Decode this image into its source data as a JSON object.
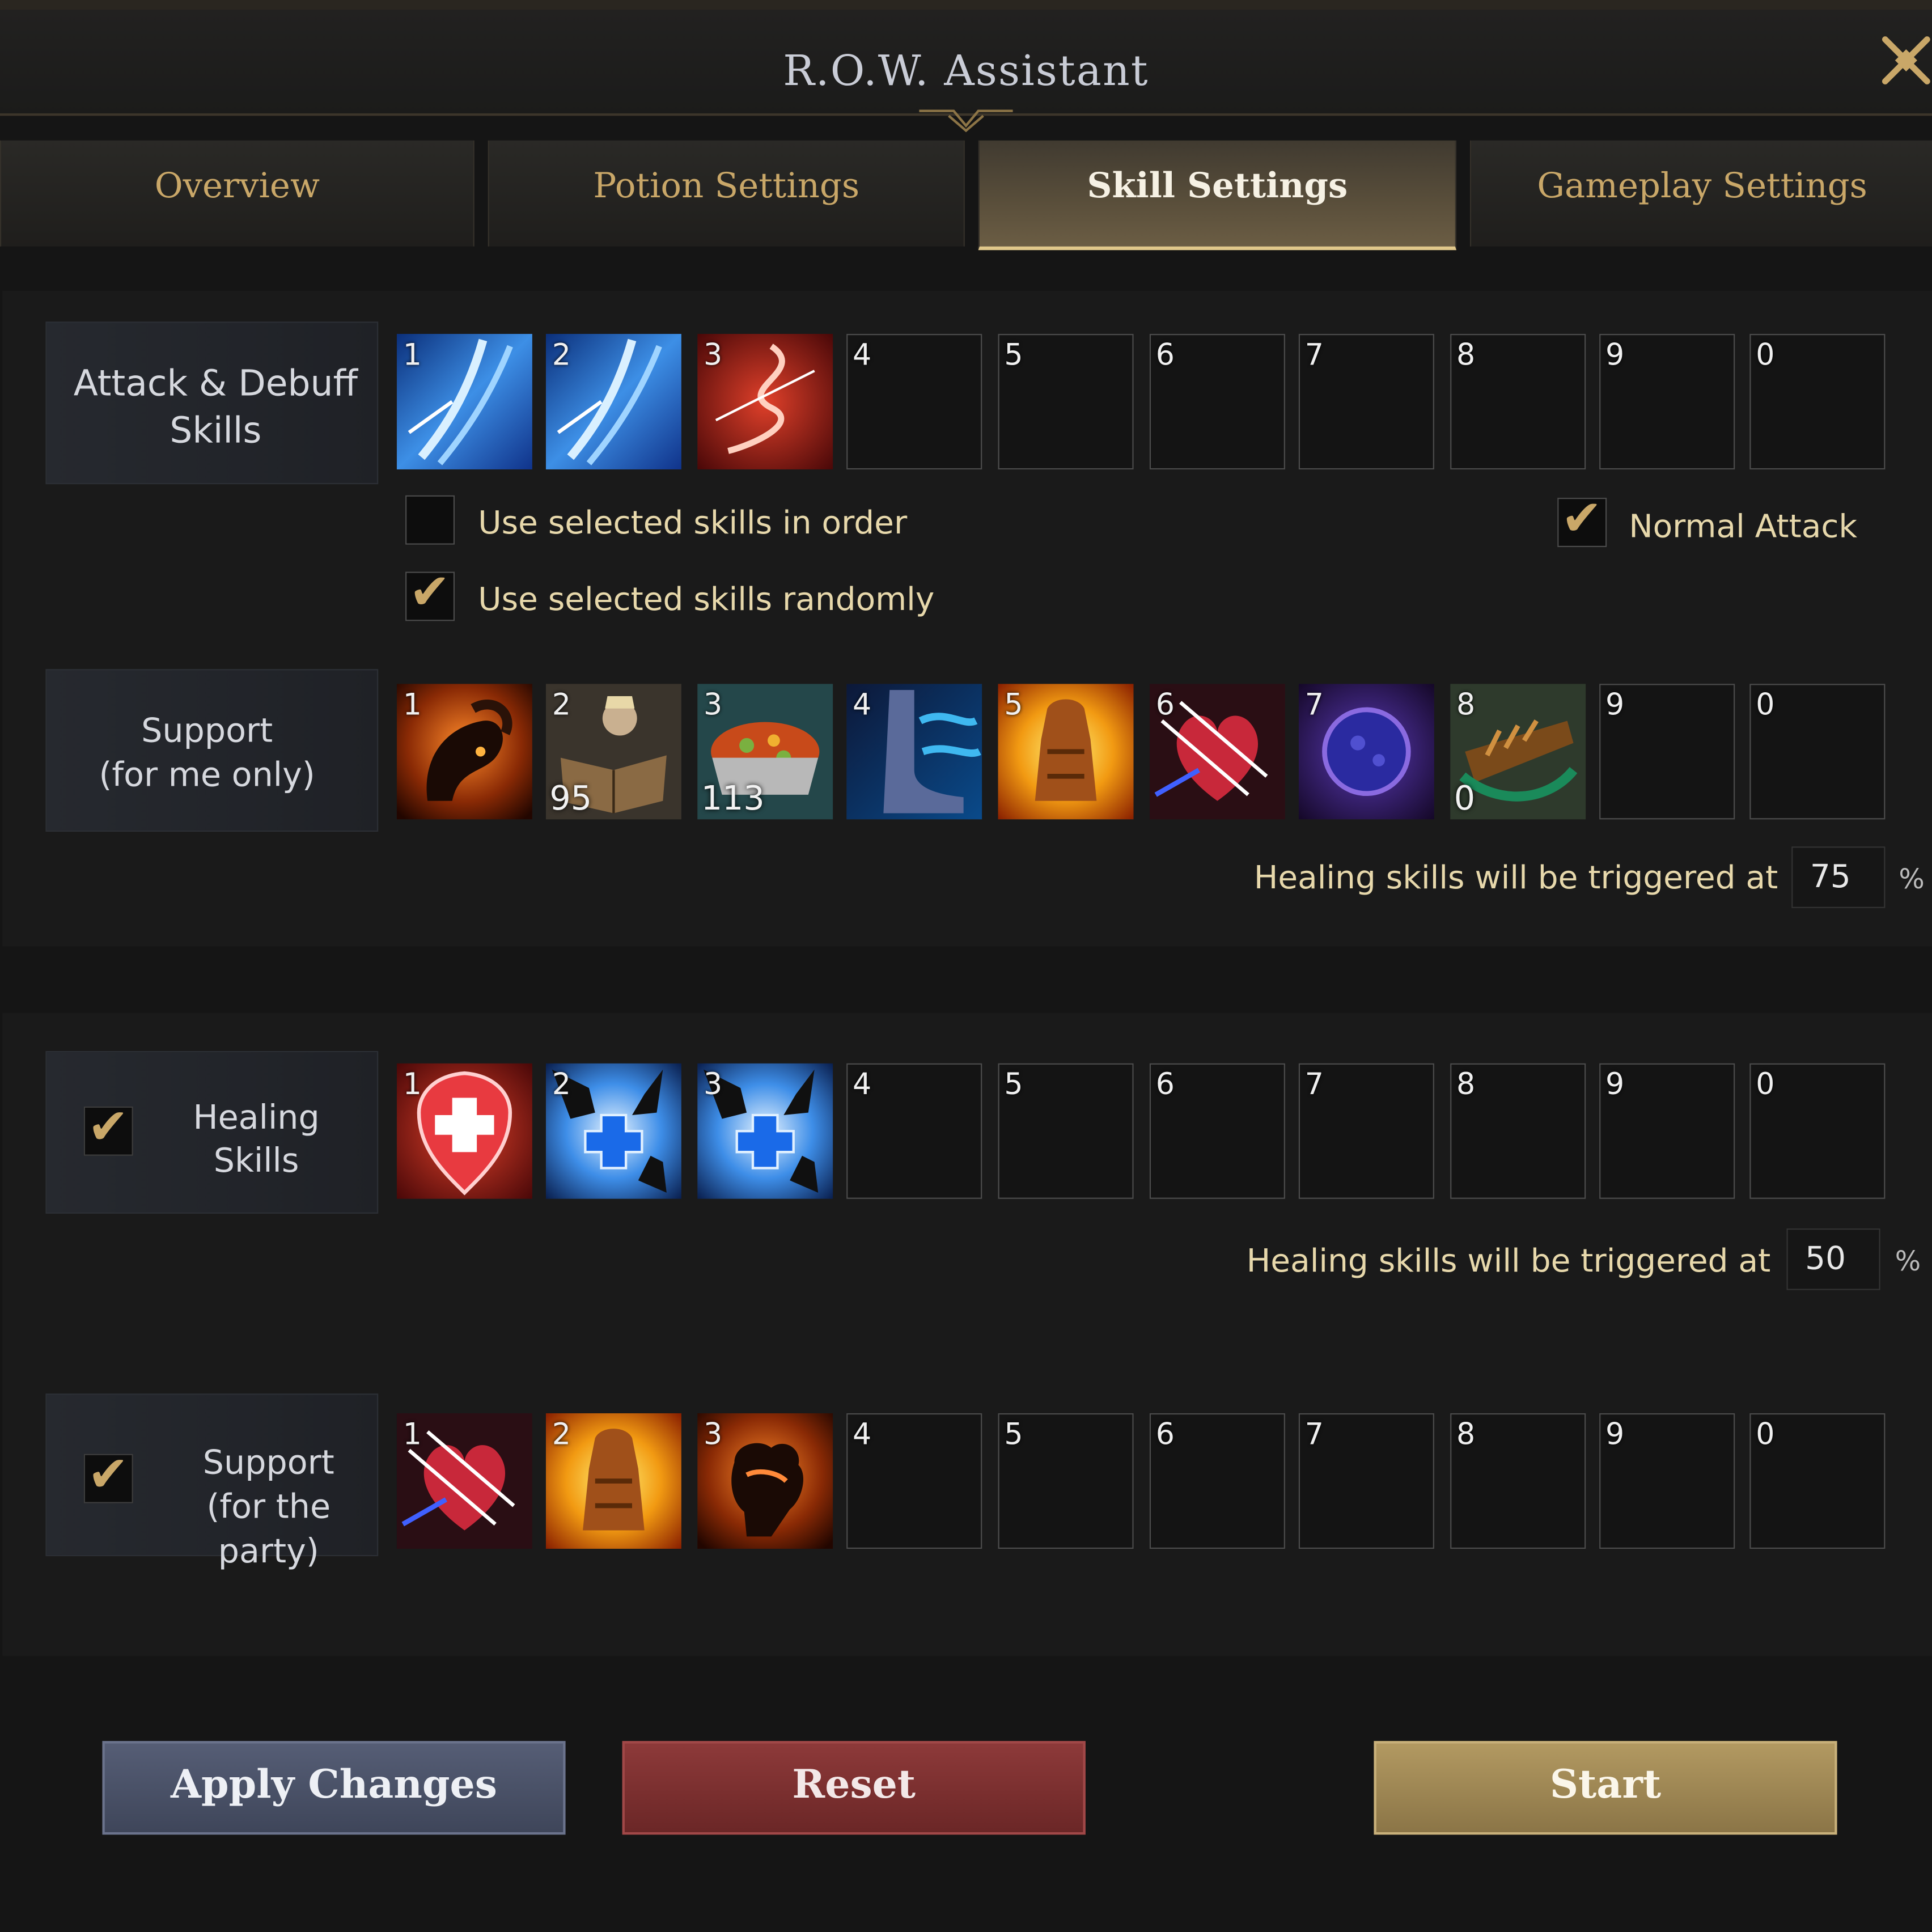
{
  "window": {
    "title": "R.O.W. Assistant"
  },
  "tabs": [
    {
      "label": "Overview"
    },
    {
      "label": "Potion Settings"
    },
    {
      "label": "Skill Settings"
    },
    {
      "label": "Gameplay Settings"
    }
  ],
  "active_tab": "Skill Settings",
  "attack": {
    "label_line1": "Attack & Debuff",
    "label_line2": "Skills",
    "slots": [
      "1",
      "2",
      "3",
      "4",
      "5",
      "6",
      "7",
      "8",
      "9",
      "0"
    ],
    "filled_icons": [
      "ice-slash-icon",
      "ice-slash-icon",
      "fire-whip-icon"
    ],
    "opt_in_order": "Use selected skills in order",
    "opt_randomly": "Use selected skills randomly",
    "opt_normal_attack": "Normal Attack",
    "in_order_checked": false,
    "randomly_checked": true,
    "normal_attack_checked": true
  },
  "support_me": {
    "label_line1": "Support",
    "label_line2": "(for me only)",
    "slots": [
      "1",
      "2",
      "3",
      "4",
      "5",
      "6",
      "7",
      "8",
      "9",
      "0"
    ],
    "filled_icons": [
      "beast-rage-icon",
      "spellbook-icon",
      "stew-bowl-icon",
      "swift-boots-icon",
      "golden-armor-icon",
      "heart-strike-icon",
      "arcane-orb-icon",
      "bread-food-icon"
    ],
    "counts": {
      "2": "95",
      "3": "113",
      "8": "0"
    },
    "trigger_label": "Healing skills will be triggered at",
    "trigger_value": "75",
    "percent": "%"
  },
  "healing": {
    "label_line1": "Healing",
    "label_line2": "Skills",
    "enabled": true,
    "slots": [
      "1",
      "2",
      "3",
      "4",
      "5",
      "6",
      "7",
      "8",
      "9",
      "0"
    ],
    "filled_icons": [
      "heal-shield-icon",
      "healing-hands-icon",
      "healing-hands-icon"
    ],
    "trigger_label": "Healing skills will be triggered at",
    "trigger_value": "50",
    "percent": "%"
  },
  "support_party": {
    "label_line1": "Support",
    "label_line2": "(for the party)",
    "enabled": true,
    "slots": [
      "1",
      "2",
      "3",
      "4",
      "5",
      "6",
      "7",
      "8",
      "9",
      "0"
    ],
    "filled_icons": [
      "heart-strike-icon",
      "golden-armor-icon",
      "fist-icon"
    ]
  },
  "buttons": {
    "apply": "Apply Changes",
    "reset": "Reset",
    "start": "Start"
  },
  "colors": {
    "accent_gold": "#c9a768",
    "apply_blue": "#4a5268",
    "reset_red": "#7a2f30",
    "start_gold": "#9a8454"
  }
}
